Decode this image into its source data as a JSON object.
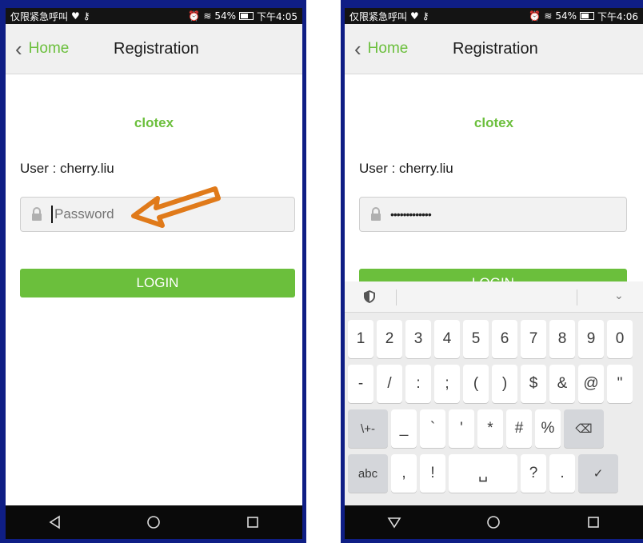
{
  "left": {
    "status": {
      "left_text": "仅限紧急呼叫",
      "right_text": "54%",
      "time": "下午4:05"
    },
    "back_label": "Home",
    "title": "Registration",
    "brand": "clotex",
    "user_label": "User : cherry.liu",
    "password_placeholder": "Password",
    "login_label": "LOGIN",
    "nav": {
      "back_icon": "triangle-back-icon",
      "home_icon": "circle-home-icon",
      "recents_icon": "square-recents-icon"
    }
  },
  "right": {
    "status": {
      "left_text": "仅限紧急呼叫",
      "right_text": "54%",
      "time": "下午4:06"
    },
    "back_label": "Home",
    "title": "Registration",
    "brand": "clotex",
    "user_label": "User : cherry.liu",
    "password_masked": "•••••••••••••",
    "login_label": "LOGIN",
    "keyboard": {
      "row1": [
        "1",
        "2",
        "3",
        "4",
        "5",
        "6",
        "7",
        "8",
        "9",
        "0"
      ],
      "row2": [
        "-",
        "/",
        ":",
        ";",
        "(",
        ")",
        "$",
        "&",
        "@",
        "\""
      ],
      "row3": [
        "\\+-",
        "_",
        "`",
        "'",
        "*",
        "#",
        "%",
        "⌫"
      ],
      "row4": [
        "abc",
        ",",
        "!",
        "␣",
        "?",
        ".",
        "✓"
      ]
    }
  },
  "colors": {
    "accent": "#6bbf3c",
    "frame": "#0f1e85",
    "arrow": "#e07a1a"
  }
}
